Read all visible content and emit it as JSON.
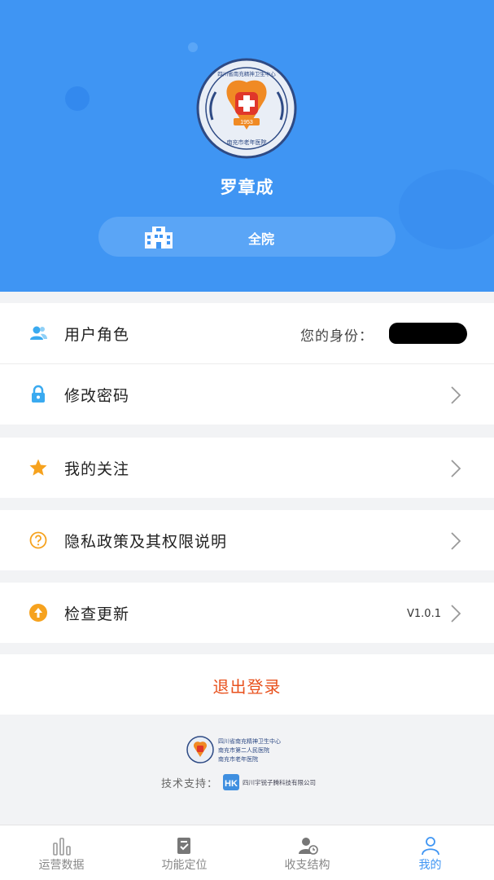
{
  "profile": {
    "name": "罗章成",
    "scope_label": "全院",
    "logo_text": {
      "top": "四川省南充精神卫生中心",
      "bottom": "南充市老年医院",
      "year": "1953"
    }
  },
  "menu": {
    "role": {
      "label": "用户角色",
      "value": "您的身份："
    },
    "password": {
      "label": "修改密码"
    },
    "favorites": {
      "label": "我的关注"
    },
    "privacy": {
      "label": "隐私政策及其权限说明"
    },
    "update": {
      "label": "检查更新",
      "version": "V1.0.1"
    }
  },
  "logout_label": "退出登录",
  "footer": {
    "org_lines": [
      "四川省南充精神卫生中心",
      "南充市第二人民医院",
      "南充市老年医院"
    ],
    "support_label": "技术支持：",
    "support_company": "四川宇锐子腾科技有限公司"
  },
  "tabs": [
    {
      "label": "运营数据",
      "icon": "bar-chart-icon",
      "active": false
    },
    {
      "label": "功能定位",
      "icon": "doc-check-icon",
      "active": false
    },
    {
      "label": "收支结构",
      "icon": "user-clock-icon",
      "active": false
    },
    {
      "label": "我的",
      "icon": "person-icon",
      "active": true
    }
  ],
  "colors": {
    "header_blue": "#3f95f3",
    "logout_orange": "#e8511d",
    "active_tab": "#3f95f3",
    "lock_blue": "#3aaaf0",
    "star_orange": "#f6a21e"
  }
}
